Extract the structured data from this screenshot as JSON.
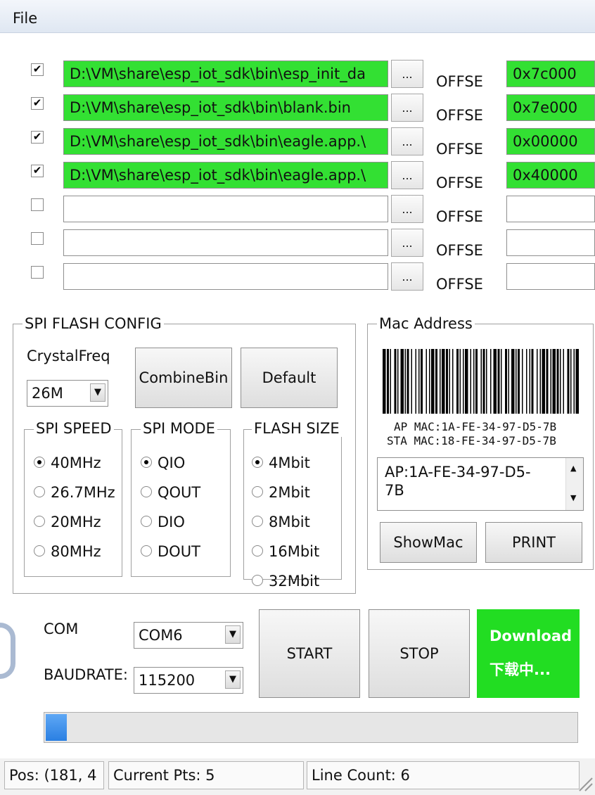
{
  "menu": {
    "file": "File"
  },
  "files": [
    {
      "checked": "✔",
      "path": "D:\\VM\\share\\esp_iot_sdk\\bin\\esp_init_da",
      "browse": "...",
      "offset_label": "OFFSE",
      "offset": "0x7c000"
    },
    {
      "checked": "✔",
      "path": "D:\\VM\\share\\esp_iot_sdk\\bin\\blank.bin",
      "browse": "...",
      "offset_label": "OFFSE",
      "offset": "0x7e000"
    },
    {
      "checked": "✔",
      "path": "D:\\VM\\share\\esp_iot_sdk\\bin\\eagle.app.\\",
      "browse": "...",
      "offset_label": "OFFSE",
      "offset": "0x00000"
    },
    {
      "checked": "✔",
      "path": "D:\\VM\\share\\esp_iot_sdk\\bin\\eagle.app.\\",
      "browse": "...",
      "offset_label": "OFFSE",
      "offset": "0x40000"
    },
    {
      "checked": "",
      "path": "",
      "browse": "...",
      "offset_label": "OFFSE",
      "offset": ""
    },
    {
      "checked": "",
      "path": "",
      "browse": "...",
      "offset_label": "OFFSE",
      "offset": ""
    },
    {
      "checked": "",
      "path": "",
      "browse": "...",
      "offset_label": "OFFSE",
      "offset": ""
    }
  ],
  "spi_config": {
    "title": "SPI FLASH CONFIG",
    "crystal_label": "CrystalFreq",
    "crystal_value": "26M",
    "combine_button": "CombineBin",
    "default_button": "Default",
    "speed": {
      "title": "SPI SPEED",
      "options": [
        "40MHz",
        "26.7MHz",
        "20MHz",
        "80MHz"
      ],
      "selected": 0
    },
    "mode": {
      "title": "SPI MODE",
      "options": [
        "QIO",
        "QOUT",
        "DIO",
        "DOUT"
      ],
      "selected": 0
    },
    "flash": {
      "title": "FLASH SIZE",
      "options": [
        "4Mbit",
        "2Mbit",
        "8Mbit",
        "16Mbit",
        "32Mbit"
      ],
      "selected": 0
    }
  },
  "mac": {
    "title": "Mac Address",
    "ap_line": "AP MAC:1A-FE-34-97-D5-7B",
    "sta_line": "STA MAC:18-FE-34-97-D5-7B",
    "text_line1": "AP:1A-FE-34-97-D5-",
    "text_line2": "7B",
    "show_button": "ShowMac",
    "print_button": "PRINT"
  },
  "connection": {
    "com_label": "COM",
    "com_value": "COM6",
    "baud_label": "BAUDRATE:",
    "baud_value": "115200",
    "start_button": "START",
    "stop_button": "STOP",
    "download_line1": "Download",
    "download_line2": "下载中...",
    "download_color": "#22dd22",
    "progress": 0.04
  },
  "statusbar": {
    "pos": "Pos: (181, 4",
    "current_pts": "Current Pts: 5",
    "line_count": "Line Count: 6"
  }
}
